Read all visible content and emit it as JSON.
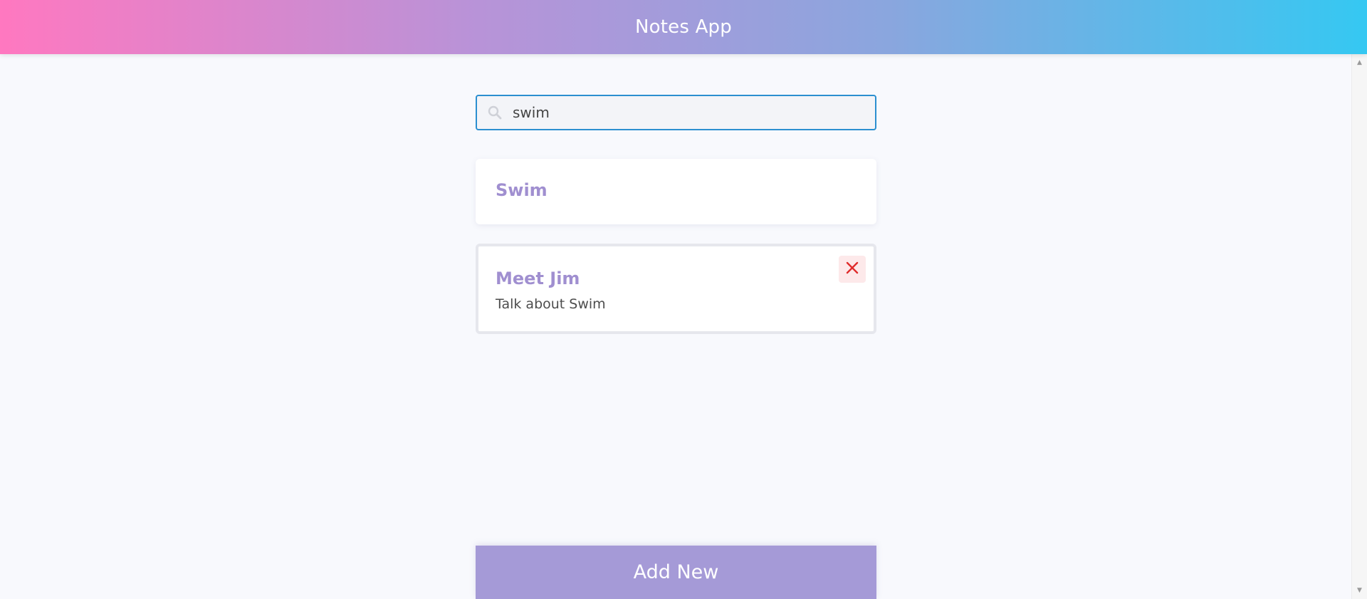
{
  "app": {
    "title": "Notes App"
  },
  "search": {
    "value": "swim",
    "icon": "search-icon"
  },
  "notes": [
    {
      "title": "Swim",
      "body": ""
    },
    {
      "title": "Meet Jim",
      "body": "Talk about Swim",
      "delete_icon": "close-icon"
    }
  ],
  "actions": {
    "add_new_label": "Add New"
  },
  "colors": {
    "header_gradient_start": "#ff78c0",
    "header_gradient_end": "#35c8f2",
    "note_title": "#a08fd0",
    "search_border": "#2b8fd0",
    "add_button": "#a59ad7",
    "delete": "#e02c2c"
  }
}
